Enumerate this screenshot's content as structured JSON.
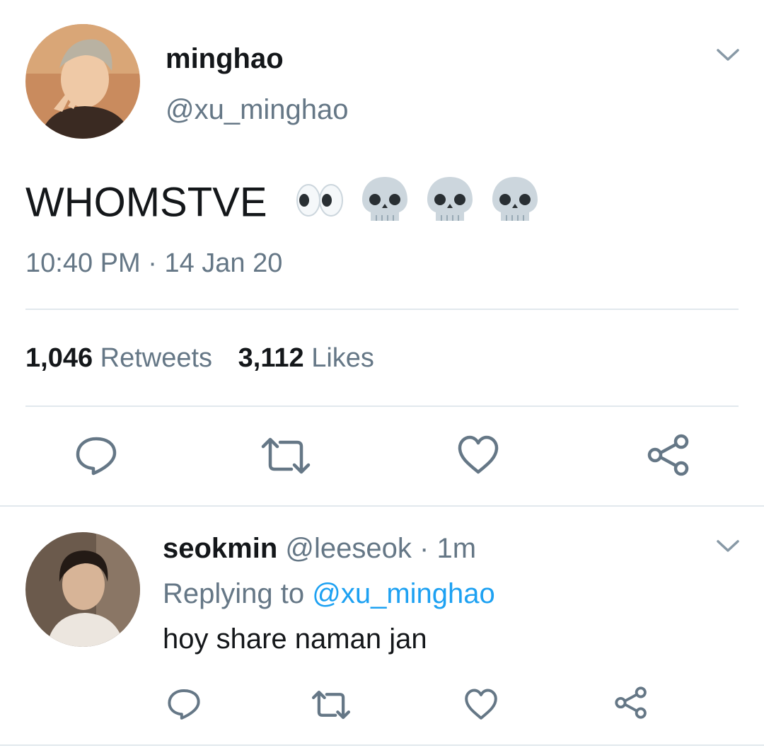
{
  "tweet": {
    "display_name": "minghao",
    "handle": "@xu_minghao",
    "text": "WHOMSTVE",
    "emojis": [
      "eyes-emoji",
      "skull-emoji",
      "skull-emoji",
      "skull-emoji"
    ],
    "time": "10:40 PM",
    "separator": "·",
    "date": "14 Jan 20",
    "retweets_count": "1,046",
    "retweets_label": "Retweets",
    "likes_count": "3,112",
    "likes_label": "Likes"
  },
  "reply": {
    "display_name": "seokmin",
    "handle": "@leeseok",
    "separator": "·",
    "age": "1m",
    "replying_label": "Replying to",
    "replying_handle": "@xu_minghao",
    "text": "hoy share naman jan"
  },
  "colors": {
    "text": "#14171a",
    "secondary": "#657786",
    "link": "#1da1f2",
    "divider": "#e1e8ed"
  },
  "icons": [
    "chevron-down-icon",
    "reply-icon",
    "retweet-icon",
    "like-icon",
    "share-icon"
  ]
}
